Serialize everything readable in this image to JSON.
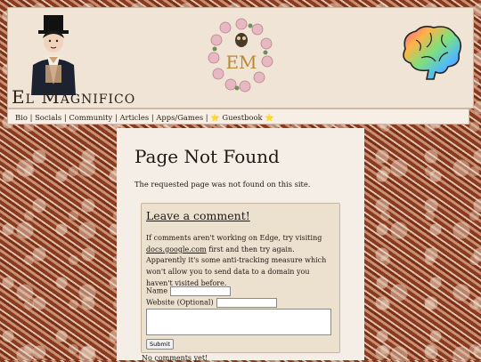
{
  "site": {
    "title": "El Magnifico",
    "emblem_text": "EM"
  },
  "nav": {
    "items": [
      "Bio",
      "Socials",
      "Community",
      "Articles",
      "Apps/Games",
      "⭐ Guestbook ⭐"
    ],
    "separator": "|"
  },
  "page": {
    "title": "Page Not Found",
    "description": "The requested page was not found on this site."
  },
  "comments": {
    "heading": "Leave a comment!",
    "info_before": "If comments aren't working on Edge, try visiting ",
    "info_link": "docs.google.com",
    "info_after": " first and then try again. Apparently it's some anti-tracking measure which won't allow you to send data to a domain you haven't visited before.",
    "name_label": "Name",
    "name_value": "",
    "website_label": "Website (Optional)",
    "website_value": "",
    "message_value": "",
    "submit_label": "Submit",
    "empty_text": "No comments yet!"
  }
}
